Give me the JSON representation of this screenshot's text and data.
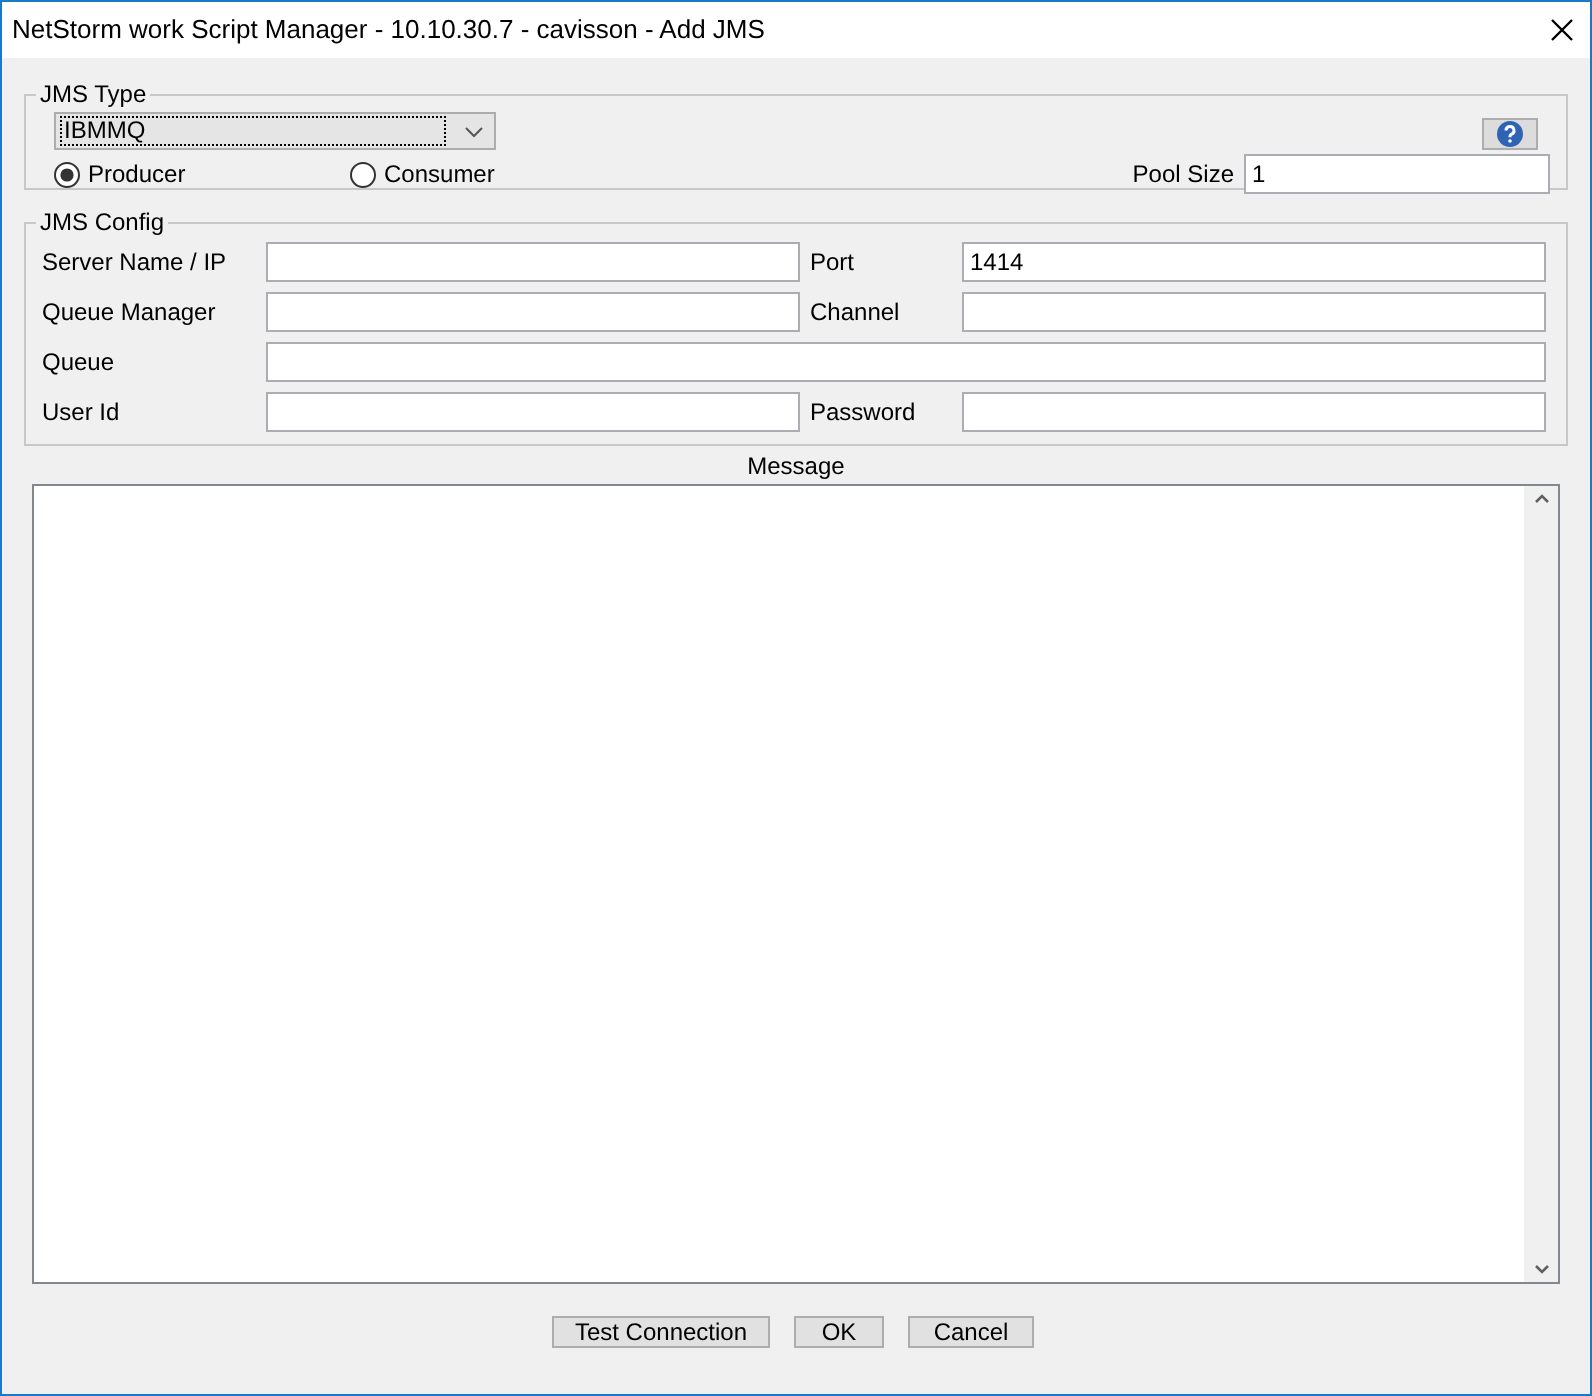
{
  "window": {
    "title": "NetStorm work Script Manager - 10.10.30.7 - cavisson - Add JMS"
  },
  "jms_type": {
    "legend": "JMS Type",
    "dropdown": {
      "value": "IBMMQ"
    },
    "help_button": true,
    "radios": [
      {
        "label": "Producer",
        "selected": true
      },
      {
        "label": "Consumer",
        "selected": false
      }
    ],
    "pool_size": {
      "label": "Pool Size",
      "value": "1"
    }
  },
  "jms_config": {
    "legend": "JMS Config",
    "rows": [
      [
        {
          "label": "Server Name / IP"
        },
        {
          "label": "Port",
          "value": "1414"
        }
      ],
      [
        {
          "label": "Queue Manager"
        },
        {
          "label": "Channel"
        }
      ],
      [
        {
          "label": "Queue"
        }
      ],
      [
        {
          "label": "User Id"
        },
        {
          "label": "Password"
        }
      ]
    ]
  },
  "message": {
    "label": "Message"
  },
  "buttons": [
    "Test Connection",
    "OK",
    "Cancel"
  ]
}
